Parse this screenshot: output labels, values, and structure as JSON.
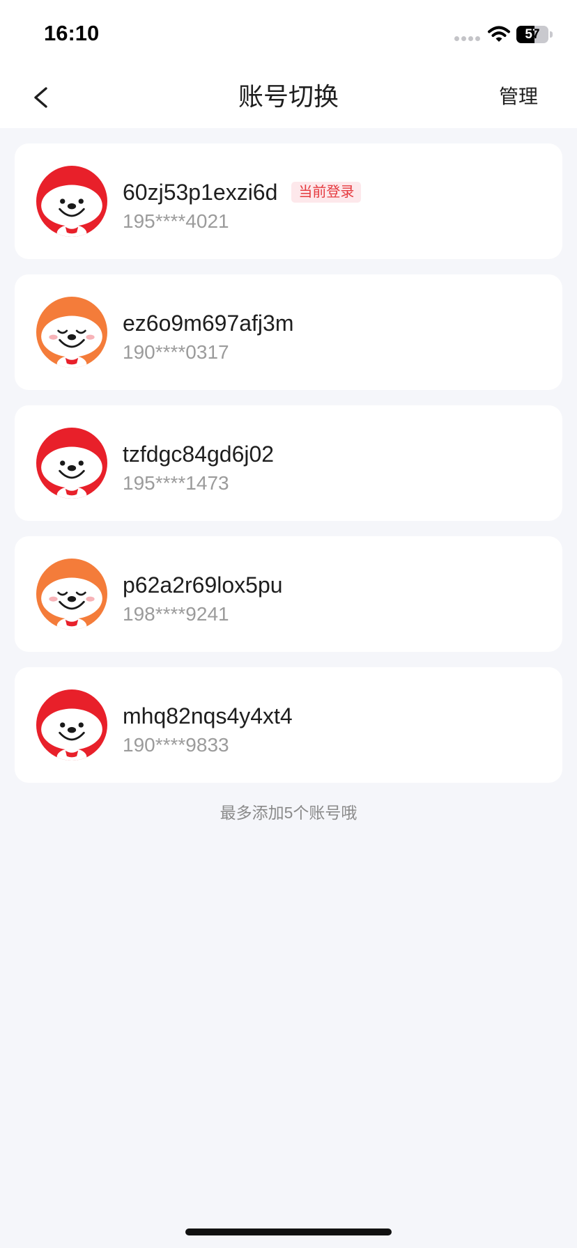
{
  "status_bar": {
    "time": "16:10",
    "battery_label": "57",
    "battery_level": 57,
    "icons": {
      "signal": "signal-dots-icon",
      "wifi": "wifi-icon",
      "battery": "battery-icon"
    }
  },
  "nav": {
    "back_icon": "chevron-left-icon",
    "title": "账号切换",
    "manage_label": "管理"
  },
  "accounts": [
    {
      "username": "60zj53p1exzi6d",
      "phone": "195****4021",
      "badge": "当前登录",
      "avatar_icon": "mascot-red-icon"
    },
    {
      "username": "ez6o9m697afj3m",
      "phone": "190****0317",
      "avatar_icon": "mascot-orange-icon"
    },
    {
      "username": "tzfdgc84gd6j02",
      "phone": "195****1473",
      "avatar_icon": "mascot-red-icon"
    },
    {
      "username": "p62a2r69lox5pu",
      "phone": "198****9241",
      "avatar_icon": "mascot-orange-icon"
    },
    {
      "username": "mhq82nqs4y4xt4",
      "phone": "190****9833",
      "avatar_icon": "mascot-red-icon"
    }
  ],
  "footer": {
    "note": "最多添加5个账号哦"
  },
  "colors": {
    "page_background": "#f5f6fa",
    "card_background": "#ffffff",
    "badge_background": "#fde8eb",
    "badge_text": "#e53a3f",
    "secondary_text": "#9b9b9b",
    "mascot_red": "#e8202a",
    "mascot_orange": "#f47c3a"
  }
}
